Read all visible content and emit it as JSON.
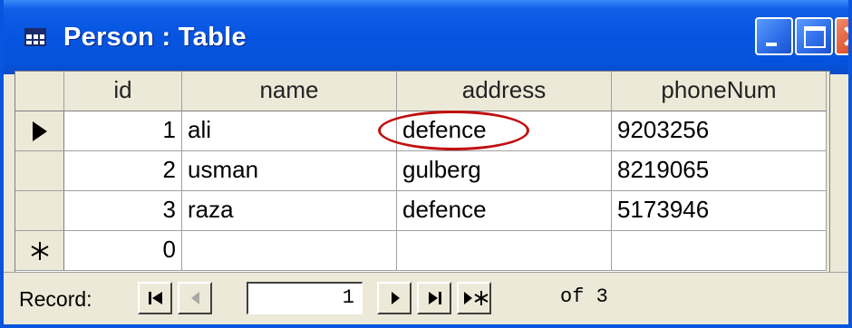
{
  "window": {
    "title": "Person : Table"
  },
  "table": {
    "columns": [
      "id",
      "name",
      "address",
      "phoneNum"
    ],
    "rows": [
      {
        "id": "1",
        "name": "ali",
        "address": "defence",
        "phoneNum": "9203256"
      },
      {
        "id": "2",
        "name": "usman",
        "address": "gulberg",
        "phoneNum": "8219065"
      },
      {
        "id": "3",
        "name": "raza",
        "address": "defence",
        "phoneNum": "5173946"
      }
    ],
    "new_row": {
      "id": "0"
    },
    "highlighted_cell": "row 1 address",
    "highlight_color": "#c01010"
  },
  "record_nav": {
    "label": "Record:",
    "current": "1",
    "of_text": "of 3"
  },
  "colors": {
    "titlebar": "#0655e0",
    "close_button": "#e05a32",
    "chrome": "#ece9d8"
  }
}
